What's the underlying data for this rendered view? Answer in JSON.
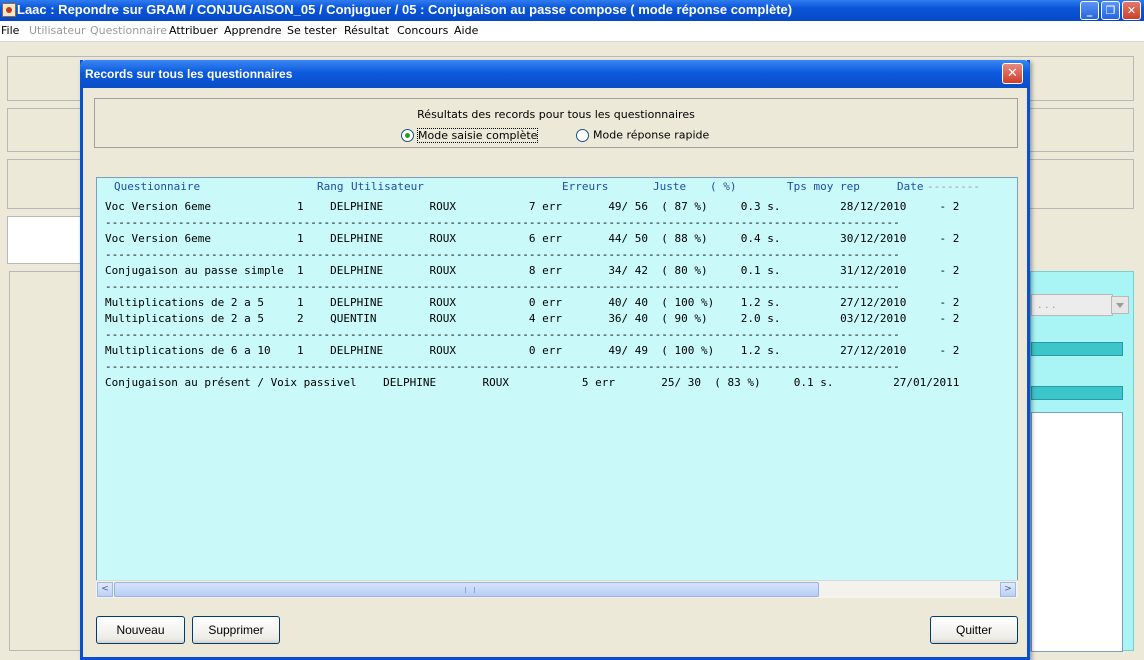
{
  "window": {
    "title": "Laac : Repondre sur GRAM / CONJUGAISON_05 / Conjuguer / 05 : Conjugaison au passe compose ( mode réponse complète)",
    "controls": {
      "minimize": "_",
      "maximize": "❐",
      "close": "✕"
    }
  },
  "menu": {
    "items": [
      {
        "label": "File",
        "enabled": true
      },
      {
        "label": "Utilisateur",
        "enabled": false
      },
      {
        "label": "Questionnaire",
        "enabled": false
      },
      {
        "label": "Attribuer",
        "enabled": true
      },
      {
        "label": "Apprendre",
        "enabled": true
      },
      {
        "label": "Se tester",
        "enabled": true
      },
      {
        "label": "Résultat",
        "enabled": true
      },
      {
        "label": "Concours",
        "enabled": true
      },
      {
        "label": "Aide",
        "enabled": true
      }
    ]
  },
  "background": {
    "combo_value": ". . ."
  },
  "dialog": {
    "title": "Records sur tous les questionnaires",
    "close": "✕",
    "header_caption": "Résultats des records pour tous les questionnaires",
    "modes": [
      {
        "label": "Mode saisie complète",
        "selected": true
      },
      {
        "label": "Mode réponse rapide",
        "selected": false
      }
    ],
    "columns": [
      "Questionnaire",
      "Rang",
      "Utilisateur",
      "Erreurs",
      "Juste",
      "( %)",
      "Tps moy rep",
      "Date"
    ],
    "rows": [
      "Voc Version 6eme             1    DELPHINE       ROUX           7 err       49/ 56  ( 87 %)     0.3 s.         28/12/2010     - 2",
      "Voc Version 6eme             1    DELPHINE       ROUX           6 err       44/ 50  ( 88 %)     0.4 s.         30/12/2010     - 2",
      "Conjugaison au passe simple  1    DELPHINE       ROUX           8 err       34/ 42  ( 80 %)     0.1 s.         31/12/2010     - 2",
      "Multiplications de 2 a 5     1    DELPHINE       ROUX           0 err       40/ 40  ( 100 %)    1.2 s.         27/12/2010     - 2",
      "Multiplications de 2 a 5     2    QUENTIN        ROUX           4 err       36/ 40  ( 90 %)     2.0 s.         03/12/2010     - 2",
      "Multiplications de 6 a 10    1    DELPHINE       ROUX           0 err       49/ 49  ( 100 %)    1.2 s.         27/12/2010     - 2",
      "Conjugaison au présent / Voix passivel    DELPHINE       ROUX           5 err       25/ 30  ( 83 %)     0.1 s.         27/01/2011"
    ],
    "separator": "------------------------------------------------------------------------------------------------------------------------",
    "scroll_left": "<",
    "scroll_right": ">",
    "buttons": {
      "nouveau": "Nouveau",
      "supprimer": "Supprimer",
      "quitter": "Quitter"
    }
  }
}
